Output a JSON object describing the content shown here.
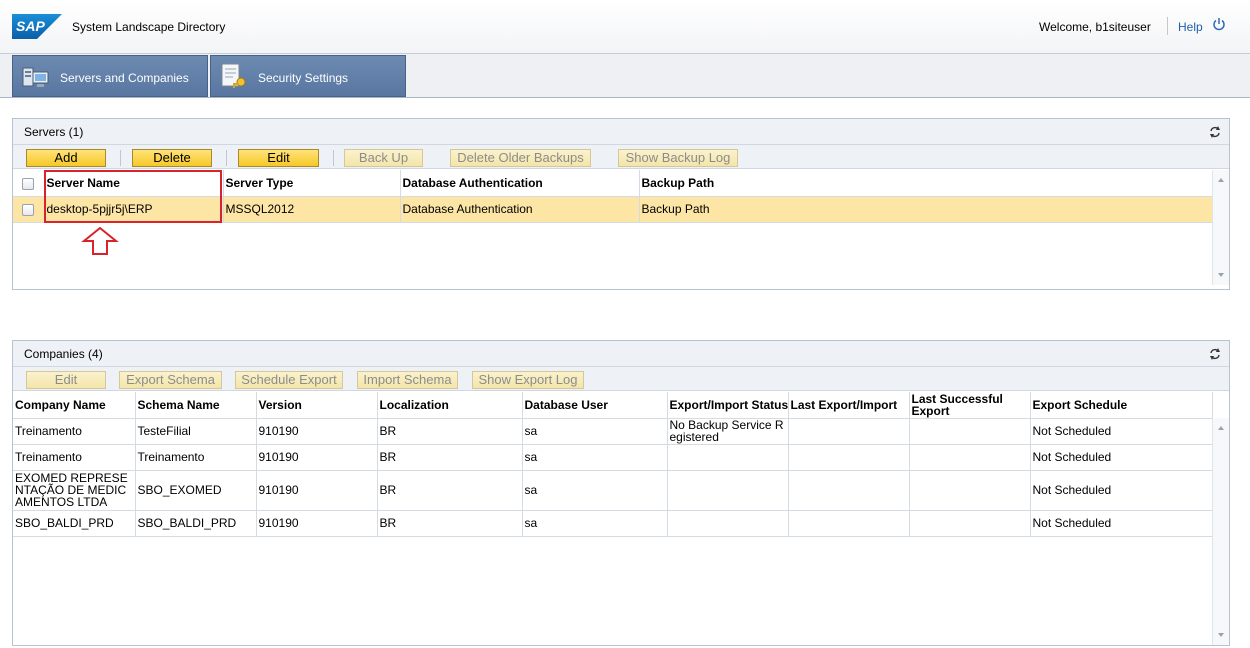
{
  "header": {
    "logo_text": "SAP",
    "app_title": "System Landscape Directory",
    "welcome": "Welcome, b1siteuser",
    "help": "Help",
    "power_icon": "power-icon"
  },
  "tabs": [
    {
      "label": "Servers and Companies",
      "icon": "servers-icon"
    },
    {
      "label": "Security Settings",
      "icon": "security-key-icon"
    }
  ],
  "servers_panel": {
    "title": "Servers (1)",
    "buttons": [
      {
        "label": "Add",
        "enabled": true
      },
      {
        "label": "Delete",
        "enabled": true
      },
      {
        "label": "Edit",
        "enabled": true
      },
      {
        "label": "Back Up",
        "enabled": false
      },
      {
        "label": "Delete Older Backups",
        "enabled": false
      },
      {
        "label": "Show Backup Log",
        "enabled": false
      }
    ],
    "columns": [
      "Server Name",
      "Server Type",
      "Database Authentication",
      "Backup Path"
    ],
    "rows": [
      {
        "server_name": "desktop-5pjjr5j\\ERP",
        "server_type": "MSSQL2012",
        "db_auth": "Database Authentication",
        "backup_path": "Backup Path",
        "selected": true
      }
    ]
  },
  "companies_panel": {
    "title": "Companies (4)",
    "buttons": [
      {
        "label": "Edit",
        "enabled": false
      },
      {
        "label": "Export Schema",
        "enabled": false
      },
      {
        "label": "Schedule Export",
        "enabled": false
      },
      {
        "label": "Import Schema",
        "enabled": false
      },
      {
        "label": "Show Export Log",
        "enabled": false
      }
    ],
    "columns": [
      "Company Name",
      "Schema Name",
      "Version",
      "Localization",
      "Database User",
      "Export/Import Status",
      "Last Export/Import",
      "Last Successful Export",
      "Export Schedule"
    ],
    "rows": [
      {
        "company": "Treinamento",
        "schema": "TesteFilial",
        "version": "910190",
        "localization": "BR",
        "db_user": "sa",
        "status": "No Backup Service Registered",
        "last": "",
        "last_success": "",
        "schedule": "Not Scheduled"
      },
      {
        "company": "Treinamento",
        "schema": "Treinamento",
        "version": "910190",
        "localization": "BR",
        "db_user": "sa",
        "status": "",
        "last": "",
        "last_success": "",
        "schedule": "Not Scheduled"
      },
      {
        "company": "EXOMED REPRESENTAÇÃO DE MEDICAMENTOS LTDA",
        "schema": "SBO_EXOMED",
        "version": "910190",
        "localization": "BR",
        "db_user": "sa",
        "status": "",
        "last": "",
        "last_success": "",
        "schedule": "Not Scheduled"
      },
      {
        "company": "SBO_BALDI_PRD",
        "schema": "SBO_BALDI_PRD",
        "version": "910190",
        "localization": "BR",
        "db_user": "sa",
        "status": "",
        "last": "",
        "last_success": "",
        "schedule": "Not Scheduled"
      }
    ]
  },
  "colors": {
    "accent_tab": "#5c7aa5",
    "button_yellow": "#f6c827",
    "selected_row": "#fde5a5",
    "annotation_red": "#d9222a"
  }
}
